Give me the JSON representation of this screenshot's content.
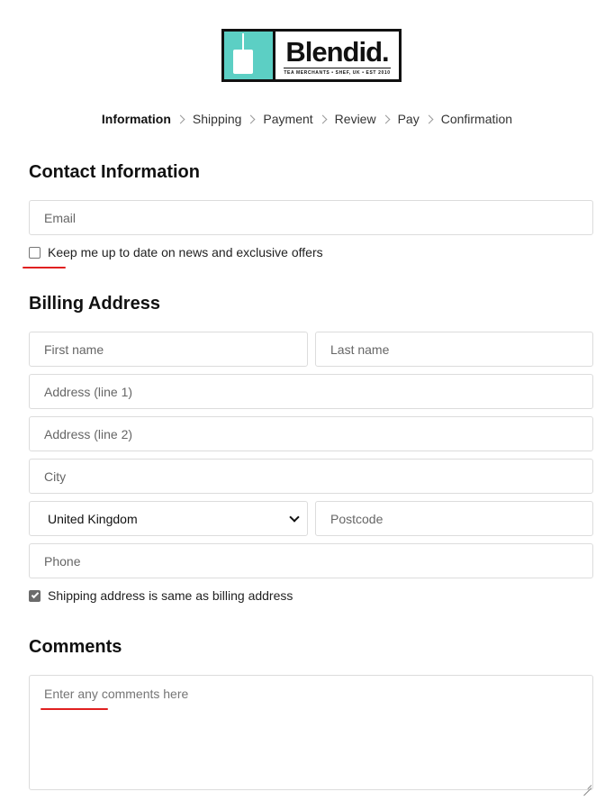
{
  "logo": {
    "name": "Blendid.",
    "tagline": "TEA MERCHANTS • SHEF, UK • EST 2010"
  },
  "breadcrumb": {
    "steps": [
      "Information",
      "Shipping",
      "Payment",
      "Review",
      "Pay",
      "Confirmation"
    ],
    "active_index": 0
  },
  "contact": {
    "title": "Contact Information",
    "email_placeholder": "Email",
    "newsletter_label": "Keep me up to date on news and exclusive offers",
    "newsletter_checked": false
  },
  "billing": {
    "title": "Billing Address",
    "first_name_placeholder": "First name",
    "last_name_placeholder": "Last name",
    "address1_placeholder": "Address (line 1)",
    "address2_placeholder": "Address (line 2)",
    "city_placeholder": "City",
    "country_value": "United Kingdom",
    "postcode_placeholder": "Postcode",
    "phone_placeholder": "Phone",
    "same_address_label": "Shipping address is same as billing address",
    "same_address_checked": true
  },
  "comments": {
    "title": "Comments",
    "placeholder": "Enter any comments here"
  },
  "colors": {
    "brand_teal": "#5ccfc4",
    "annotation_red": "#e02020"
  }
}
